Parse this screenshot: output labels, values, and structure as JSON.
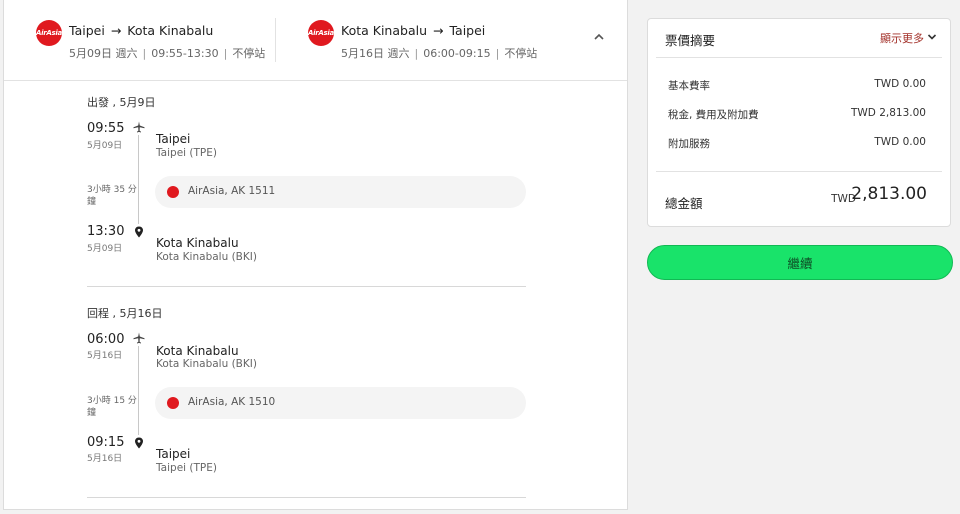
{
  "header": {
    "outbound": {
      "logo_text": "AirAsia",
      "origin": "Taipei",
      "arrow": "→",
      "destination": "Kota Kinabalu",
      "date": "5月09日 週六",
      "time_range": "09:55-13:30",
      "stops": "不停站"
    },
    "return": {
      "logo_text": "AirAsia",
      "origin": "Kota Kinabalu",
      "arrow": "→",
      "destination": "Taipei",
      "date": "5月16日 週六",
      "time_range": "06:00-09:15",
      "stops": "不停站"
    },
    "separator": "|"
  },
  "segments": [
    {
      "title": "出發 , 5月9日",
      "dep_time": "09:55",
      "dep_date": "5月09日",
      "dep_city": "Taipei",
      "dep_airport": "Taipei (TPE)",
      "duration": "3小時 35 分鐘",
      "flight": "AirAsia, AK 1511",
      "arr_time": "13:30",
      "arr_date": "5月09日",
      "arr_city": "Kota Kinabalu",
      "arr_airport": "Kota Kinabalu (BKI)"
    },
    {
      "title": "回程 , 5月16日",
      "dep_time": "06:00",
      "dep_date": "5月16日",
      "dep_city": "Kota Kinabalu",
      "dep_airport": "Kota Kinabalu (BKI)",
      "duration": "3小時 15 分鐘",
      "flight": "AirAsia, AK 1510",
      "arr_time": "09:15",
      "arr_date": "5月16日",
      "arr_city": "Taipei",
      "arr_airport": "Taipei (TPE)"
    }
  ],
  "summary": {
    "title": "票價摘要",
    "show_more": "顯示更多",
    "fees": [
      {
        "label": "基本費率",
        "value": "TWD 0.00"
      },
      {
        "label": "稅金, 費用及附加費",
        "value": "TWD 2,813.00"
      },
      {
        "label": "附加服務",
        "value": "TWD 0.00"
      }
    ],
    "total_label": "總金額",
    "total_currency": "TWD",
    "total_amount": "2,813.00"
  },
  "continue_label": "繼續",
  "colors": {
    "brand_red": "#e0191f",
    "continue_green": "#19e36a",
    "show_more_red": "#a3312a"
  }
}
